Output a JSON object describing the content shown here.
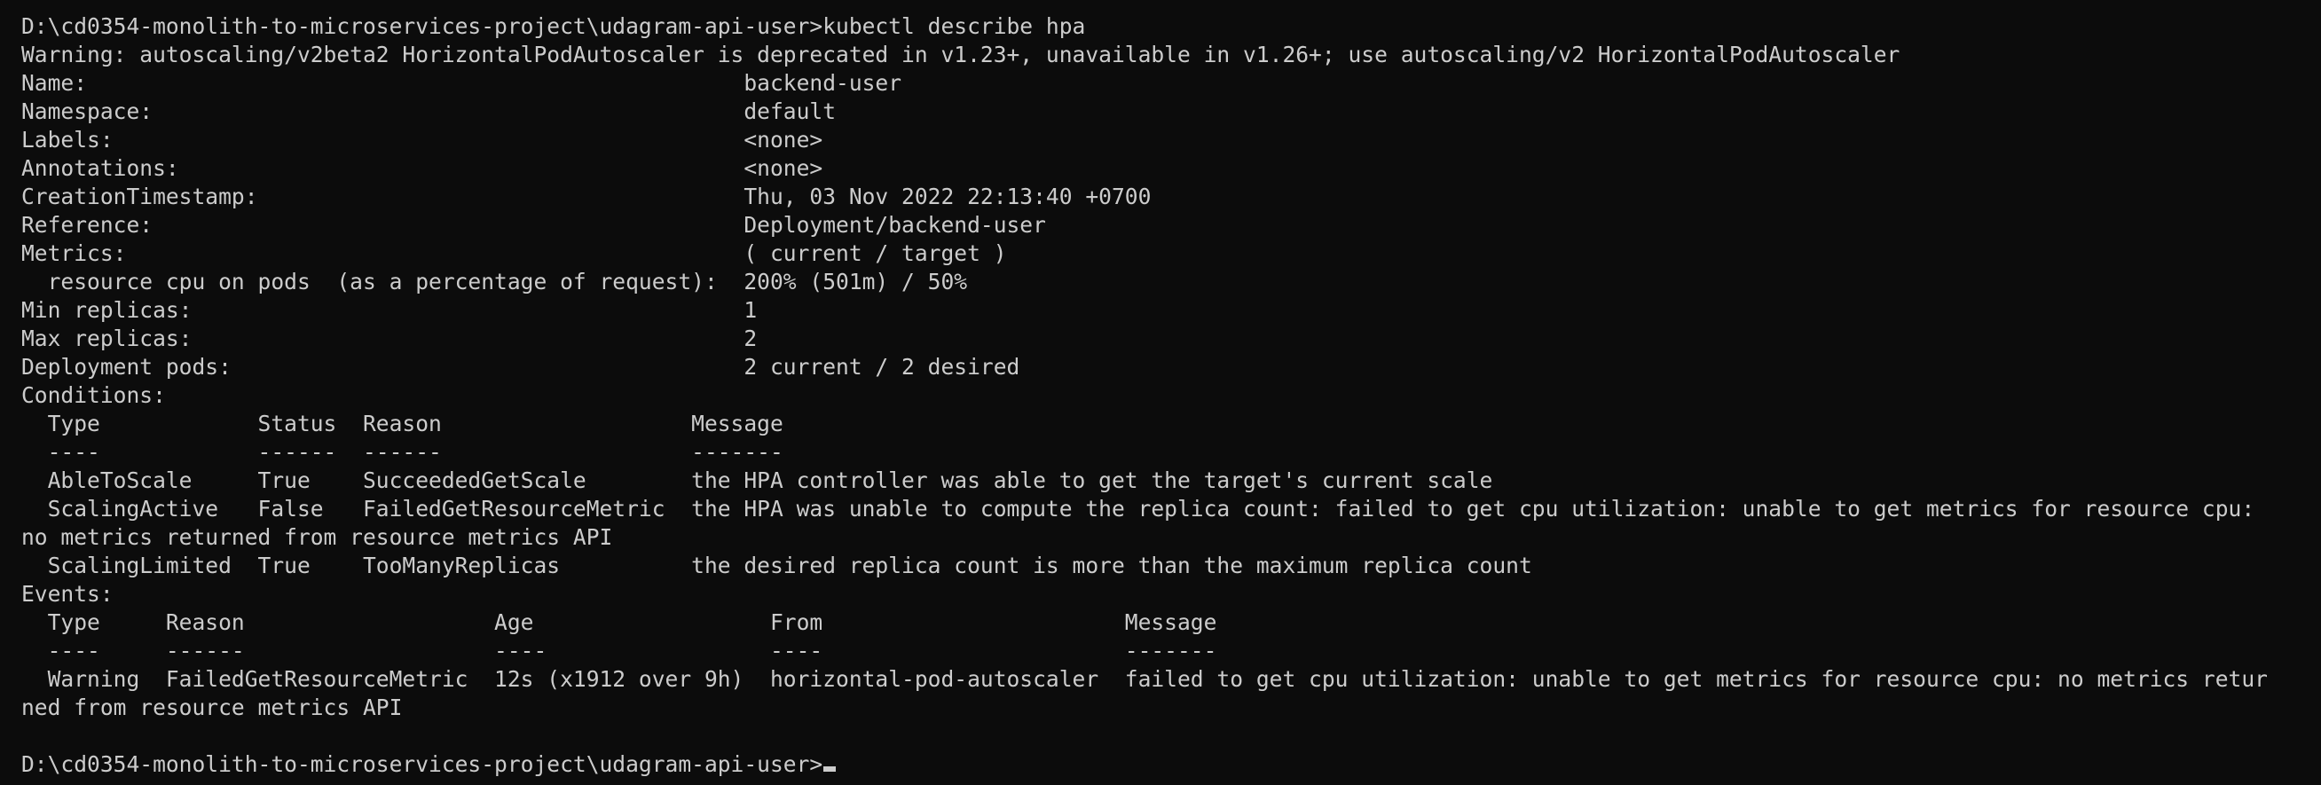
{
  "terminal": {
    "prompt": "D:\\cd0354-monolith-to-microservices-project\\udagram-api-user>",
    "command": "kubectl describe hpa",
    "lines": [
      "D:\\cd0354-monolith-to-microservices-project\\udagram-api-user>kubectl describe hpa",
      "Warning: autoscaling/v2beta2 HorizontalPodAutoscaler is deprecated in v1.23+, unavailable in v1.26+; use autoscaling/v2 HorizontalPodAutoscaler",
      "Name:                                                  backend-user",
      "Namespace:                                             default",
      "Labels:                                                <none>",
      "Annotations:                                           <none>",
      "CreationTimestamp:                                     Thu, 03 Nov 2022 22:13:40 +0700",
      "Reference:                                             Deployment/backend-user",
      "Metrics:                                               ( current / target )",
      "  resource cpu on pods  (as a percentage of request):  200% (501m) / 50%",
      "Min replicas:                                          1",
      "Max replicas:                                          2",
      "Deployment pods:                                       2 current / 2 desired",
      "Conditions:",
      "  Type            Status  Reason                   Message",
      "  ----            ------  ------                   -------",
      "  AbleToScale     True    SucceededGetScale        the HPA controller was able to get the target's current scale",
      "  ScalingActive   False   FailedGetResourceMetric  the HPA was unable to compute the replica count: failed to get cpu utilization: unable to get metrics for resource cpu:",
      "no metrics returned from resource metrics API",
      "  ScalingLimited  True    TooManyReplicas          the desired replica count is more than the maximum replica count",
      "Events:",
      "  Type     Reason                   Age                  From                       Message",
      "  ----     ------                   ----                 ----                       -------",
      "  Warning  FailedGetResourceMetric  12s (x1912 over 9h)  horizontal-pod-autoscaler  failed to get cpu utilization: unable to get metrics for resource cpu: no metrics retur",
      "ned from resource metrics API",
      "",
      "D:\\cd0354-monolith-to-microservices-project\\udagram-api-user>"
    ]
  },
  "colors": {
    "background": "#0c0c0c",
    "foreground": "#cccccc"
  }
}
